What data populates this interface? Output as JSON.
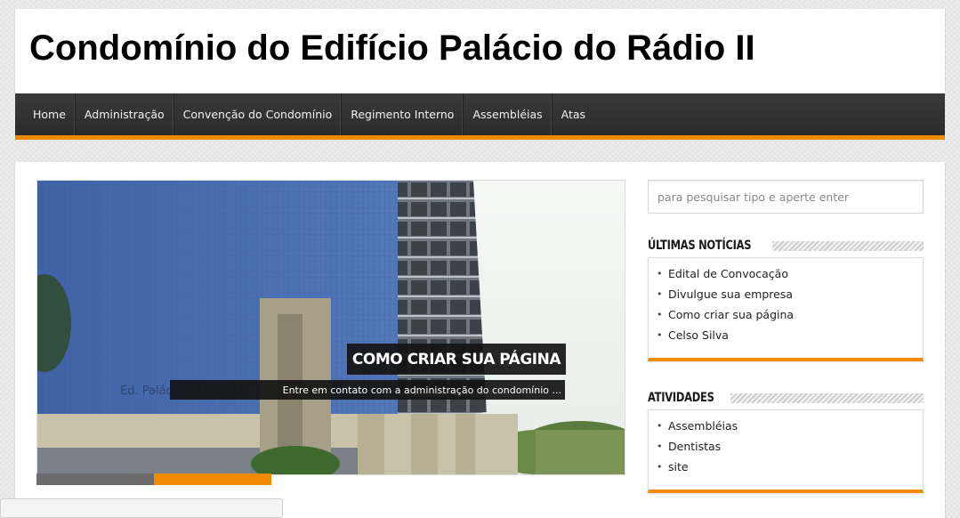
{
  "site": {
    "title": "Condomínio do Edifício Palácio do Rádio II"
  },
  "nav": {
    "items": [
      {
        "label": "Home"
      },
      {
        "label": "Administração"
      },
      {
        "label": "Convenção do Condomínio"
      },
      {
        "label": "Regimento Interno"
      },
      {
        "label": "Assembléias"
      },
      {
        "label": "Atas"
      }
    ]
  },
  "slider": {
    "title": "Como criar sua página",
    "excerpt": "Entre em contato com a administração do condomínio ...",
    "building_sign": "Ed. Palácio do Rádio II",
    "pages": 2,
    "active_page": 2
  },
  "search": {
    "placeholder": "para pesquisar tipo e aperte enter"
  },
  "widgets": {
    "latest_news": {
      "title": "Últimas Notícias",
      "items": [
        {
          "label": "Edital de Convocação"
        },
        {
          "label": "Divulgue sua empresa"
        },
        {
          "label": "Como criar sua página"
        },
        {
          "label": "Celso Silva"
        }
      ]
    },
    "activities": {
      "title": "Atividades",
      "items": [
        {
          "label": "Assembléias"
        },
        {
          "label": "Dentistas"
        },
        {
          "label": "site"
        }
      ]
    }
  },
  "colors": {
    "accent": "#f08a00",
    "nav_bg": "#2f2f2f",
    "caption_bg": "#141414"
  }
}
